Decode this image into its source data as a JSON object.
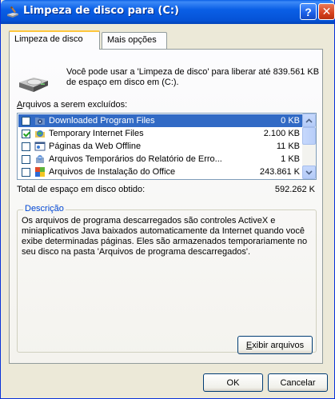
{
  "window": {
    "title": "Limpeza de disco para  (C:)",
    "help_label": "?",
    "close_label": "✕"
  },
  "tabs": [
    {
      "label": "Limpeza de disco",
      "active": true
    },
    {
      "label": "Mais opções",
      "active": false
    }
  ],
  "intro": "Você pode usar a 'Limpeza de disco' para liberar até 839.561 KB de espaço em disco em  (C:).",
  "files_label_prefix": "A",
  "files_label_rest": "rquivos a serem excluídos:",
  "files": [
    {
      "name": "Downloaded Program Files",
      "size": "0 KB",
      "checked": false,
      "selected": true,
      "icon": "folder-gear-icon"
    },
    {
      "name": "Temporary Internet Files",
      "size": "2.100 KB",
      "checked": true,
      "selected": false,
      "icon": "globe-folder-icon"
    },
    {
      "name": "Páginas da Web Offline",
      "size": "11 KB",
      "checked": false,
      "selected": false,
      "icon": "web-page-icon"
    },
    {
      "name": "Arquivos Temporários do Relatório de Erro...",
      "size": "1 KB",
      "checked": false,
      "selected": false,
      "icon": "report-icon"
    },
    {
      "name": "Arquivos de Instalação do Office",
      "size": "243.861 K",
      "checked": false,
      "selected": false,
      "icon": "office-icon"
    }
  ],
  "total_label": "Total de espaço em disco obtido:",
  "total_value": "592.262 K",
  "description_title": "Descrição",
  "description": "Os arquivos de programa descarregados são controles ActiveX e miniaplicativos Java baixados automaticamente da Internet quando você exibe determinadas páginas. Eles são armazenados temporariamente no seu disco na pasta 'Arquivos de programa descarregados'.",
  "buttons": {
    "view_files_prefix": "E",
    "view_files_rest": "xibir arquivos",
    "ok": "OK",
    "cancel": "Cancelar"
  },
  "colors": {
    "titlebar": "#0a5fe6",
    "selection": "#316ac5",
    "group_title": "#0046d5"
  }
}
